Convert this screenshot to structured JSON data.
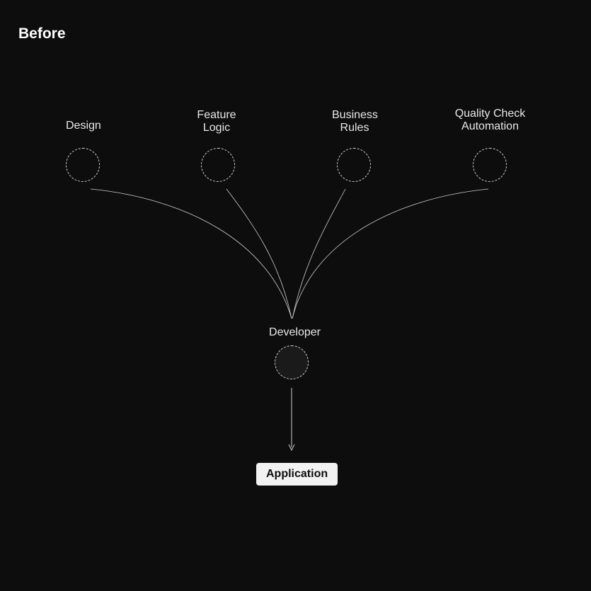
{
  "title": "Before",
  "nodes": {
    "design": {
      "label": "Design"
    },
    "featureLogic": {
      "label": "Feature\nLogic"
    },
    "businessRules": {
      "label": "Business\nRules"
    },
    "qualityCheck": {
      "label": "Quality Check\nAutomation"
    },
    "developer": {
      "label": "Developer"
    },
    "application": {
      "label": "Application"
    }
  }
}
